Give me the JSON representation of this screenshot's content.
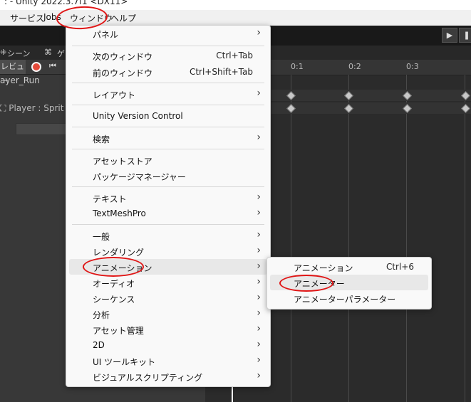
{
  "title_bar": {
    "text": ": - Unity 2022.3.7f1 <DX11>"
  },
  "menu_bar": {
    "items": [
      "サービス",
      "Jobs",
      "ウィンドウ",
      "ヘルプ"
    ]
  },
  "toolbar": {
    "play_icon": "play-icon"
  },
  "tabs": {
    "scene": "シーン",
    "game": "ゲ"
  },
  "animation": {
    "preview_label": "レビュー",
    "clip_name": "ayer_Run",
    "property": "Player : Sprit",
    "ticks": [
      "0:1",
      "0:2",
      "0:3"
    ]
  },
  "window_menu": {
    "items": [
      {
        "label": "パネル",
        "submenu": true
      },
      {
        "label": "次のウィンドウ",
        "shortcut": "Ctrl+Tab"
      },
      {
        "label": "前のウィンドウ",
        "shortcut": "Ctrl+Shift+Tab"
      },
      {
        "label": "レイアウト",
        "submenu": true
      },
      {
        "label": "Unity Version Control"
      },
      {
        "label": "検索",
        "submenu": true
      },
      {
        "label": "アセットストア"
      },
      {
        "label": "パッケージマネージャー"
      },
      {
        "label": "テキスト",
        "submenu": true
      },
      {
        "label": "TextMeshPro",
        "submenu": true
      },
      {
        "label": "一般",
        "submenu": true
      },
      {
        "label": "レンダリング",
        "submenu": true
      },
      {
        "label": "アニメーション",
        "submenu": true,
        "highlighted": true
      },
      {
        "label": "オーディオ",
        "submenu": true
      },
      {
        "label": "シーケンス",
        "submenu": true
      },
      {
        "label": "分析",
        "submenu": true
      },
      {
        "label": "アセット管理",
        "submenu": true
      },
      {
        "label": "2D",
        "submenu": true
      },
      {
        "label": "UI ツールキット",
        "submenu": true
      },
      {
        "label": "ビジュアルスクリプティング",
        "submenu": true
      }
    ]
  },
  "animation_submenu": {
    "items": [
      {
        "label": "アニメーション",
        "shortcut": "Ctrl+6"
      },
      {
        "label": "アニメーター",
        "highlighted": true
      },
      {
        "label": "アニメーターパラメーター"
      }
    ]
  },
  "colors": {
    "annotation_red": "#e01515",
    "menu_bg": "#f9f9f9",
    "editor_bg": "#383838"
  }
}
